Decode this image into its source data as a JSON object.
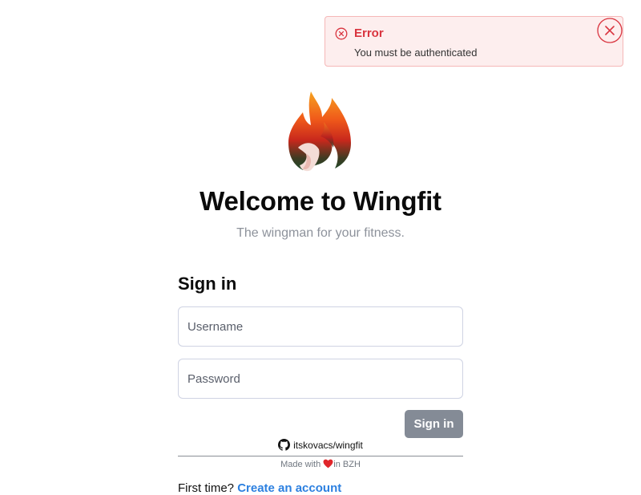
{
  "toast": {
    "title": "Error",
    "message": "You must be authenticated",
    "icon": "error-circle-icon",
    "close_icon": "close-circle-icon",
    "color": "#d9343f",
    "background": "#fdeeee"
  },
  "header": {
    "logo_icon": "wingfit-flame-logo",
    "title": "Welcome to Wingfit",
    "subtitle": "The wingman for your fitness."
  },
  "form": {
    "heading": "Sign in",
    "username": {
      "placeholder": "Username",
      "value": ""
    },
    "password": {
      "placeholder": "Password",
      "value": ""
    },
    "submit_label": "Sign in",
    "submit_color": "#848b96"
  },
  "footer": {
    "repo_icon": "github-icon",
    "repo_text": "itskovacs/wingfit",
    "made_with_prefix": "Made with",
    "heart_icon": "heart-icon",
    "made_with_suffix": "in BZH"
  },
  "signup": {
    "prompt": "First time?",
    "link_text": "Create an account",
    "link_color": "#2c80e0"
  }
}
